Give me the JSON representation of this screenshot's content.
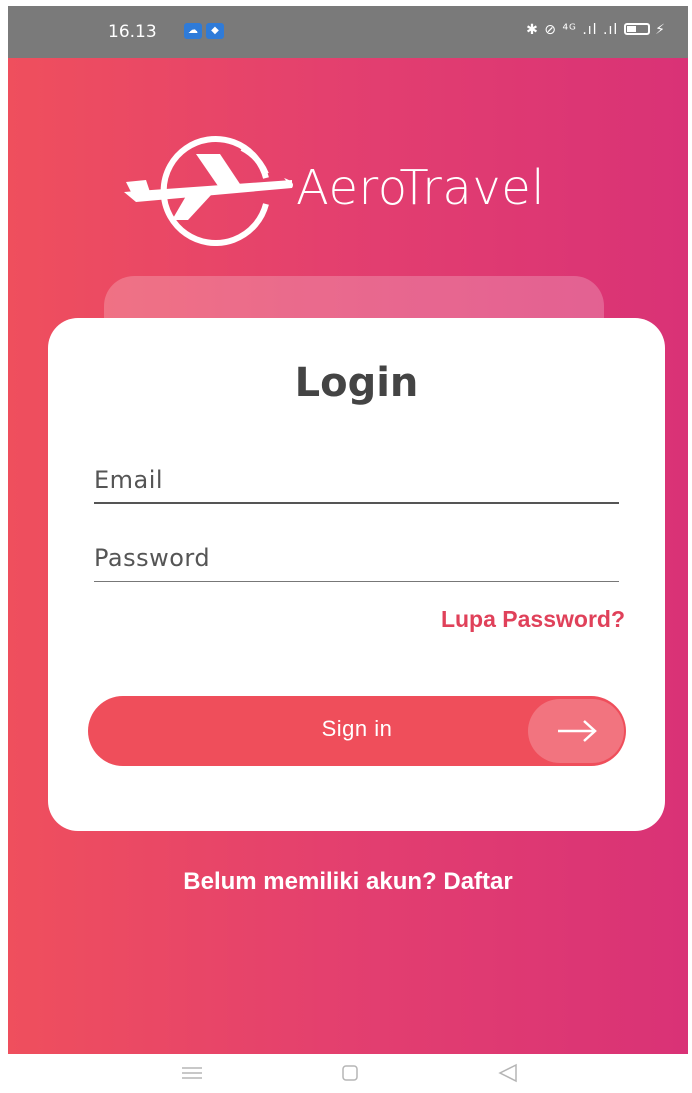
{
  "status_bar": {
    "time": "16.13",
    "indicators": "✱ ⊘ ⁴ᴳ .ıl .ıl",
    "app_icons": [
      "cloud-icon",
      "shield-icon"
    ]
  },
  "app": {
    "name": "AeroTravel",
    "logo_icon": "airplane-in-circle-icon"
  },
  "login": {
    "title": "Login",
    "email_placeholder": "Email",
    "password_placeholder": "Password",
    "forgot_link": "Lupa Password?",
    "sign_in_label": "Sign in",
    "sign_in_icon": "arrow-right-icon",
    "register_link": "Belum memiliki akun? Daftar"
  },
  "nav_bar": {
    "buttons": [
      "menu-icon",
      "home-icon",
      "back-icon"
    ]
  },
  "colors": {
    "gradient_start": "#ef4f5d",
    "gradient_end": "#d93276",
    "accent": "#ef4e5b",
    "link": "#e0415a",
    "status_bar": "#7a7a7a"
  }
}
